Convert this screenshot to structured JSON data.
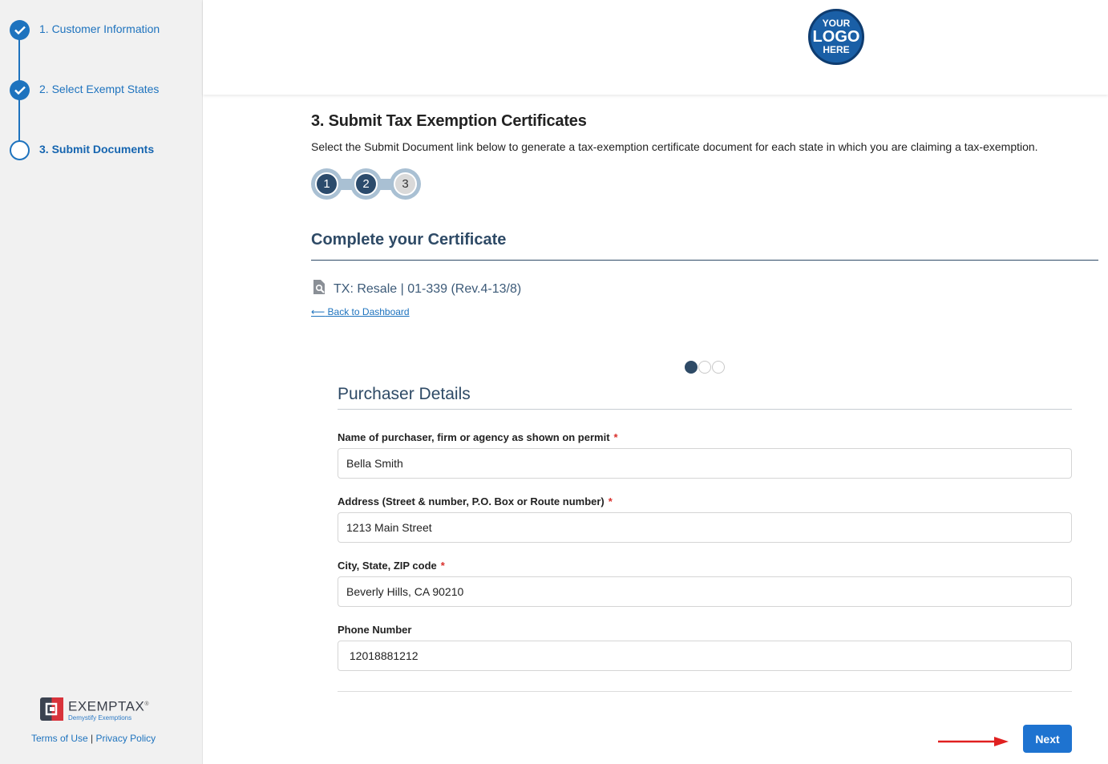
{
  "sidebar": {
    "steps": [
      {
        "label": "1. Customer Information",
        "state": "done"
      },
      {
        "label": "2. Select Exempt States",
        "state": "done"
      },
      {
        "label": "3. Submit Documents",
        "state": "current"
      }
    ],
    "brand": {
      "name": "EXEMPTAX",
      "tagline": "Demystify Exemptions",
      "reg": "®"
    },
    "footer": {
      "terms": "Terms of Use",
      "separator": "|",
      "privacy": "Privacy Policy"
    }
  },
  "header": {
    "logo": {
      "line1": "YOUR",
      "line2": "LOGO",
      "line3": "HERE"
    }
  },
  "main": {
    "title": "3. Submit Tax Exemption Certificates",
    "subtitle": "Select the Submit Document link below to generate a tax-exemption certificate document for each state in which you are claiming a tax-exemption.",
    "progress": [
      {
        "label": "1",
        "state": "done"
      },
      {
        "label": "2",
        "state": "done"
      },
      {
        "label": "3",
        "state": "todo"
      }
    ],
    "section_heading": "Complete your Certificate",
    "certificate": "TX: Resale | 01-339 (Rev.4-13/8)",
    "back_link": "Back to Dashboard",
    "pager": {
      "total": 3,
      "active": 1
    }
  },
  "form": {
    "title": "Purchaser Details",
    "fields": [
      {
        "label": "Name of purchaser, firm or agency as shown on permit",
        "required": "*",
        "value": "Bella Smith"
      },
      {
        "label": "Address (Street & number, P.O. Box or Route number)",
        "required": "*",
        "value": "1213 Main Street"
      },
      {
        "label": "City, State, ZIP code",
        "required": "*",
        "value": "Beverly Hills, CA 90210"
      },
      {
        "label": "Phone Number",
        "required": "",
        "value": " 12018881212"
      }
    ],
    "next_label": "Next"
  },
  "colors": {
    "accent": "#1e73be",
    "heading": "#2e4a66",
    "next_button": "#1e73d0",
    "annotation_arrow": "#e02020"
  }
}
